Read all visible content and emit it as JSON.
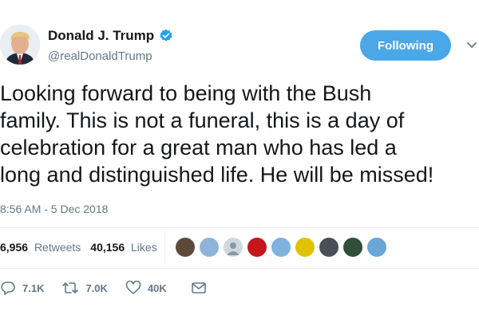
{
  "author": {
    "display_name": "Donald J. Trump",
    "handle": "@realDonaldTrump",
    "verified": true
  },
  "follow_button": {
    "label": "Following"
  },
  "tweet": {
    "lines": [
      "Looking forward to being with the Bush",
      "family. This is not a funeral, this is a day of",
      "celebration for a great man who has led a",
      "long and distinguished life. He will be missed!"
    ],
    "timestamp": "8:56 AM - 5 Dec 2018"
  },
  "stats": {
    "retweets_count": "6,956",
    "retweets_label": "Retweets",
    "likes_count": "40,156",
    "likes_label": "Likes"
  },
  "actions": {
    "reply_count": "7.1K",
    "retweet_count": "7.0K",
    "like_count": "40K"
  },
  "colors": {
    "accent": "#4aa7e8",
    "secondary_text": "#657786",
    "divider": "#e6ecf0"
  }
}
